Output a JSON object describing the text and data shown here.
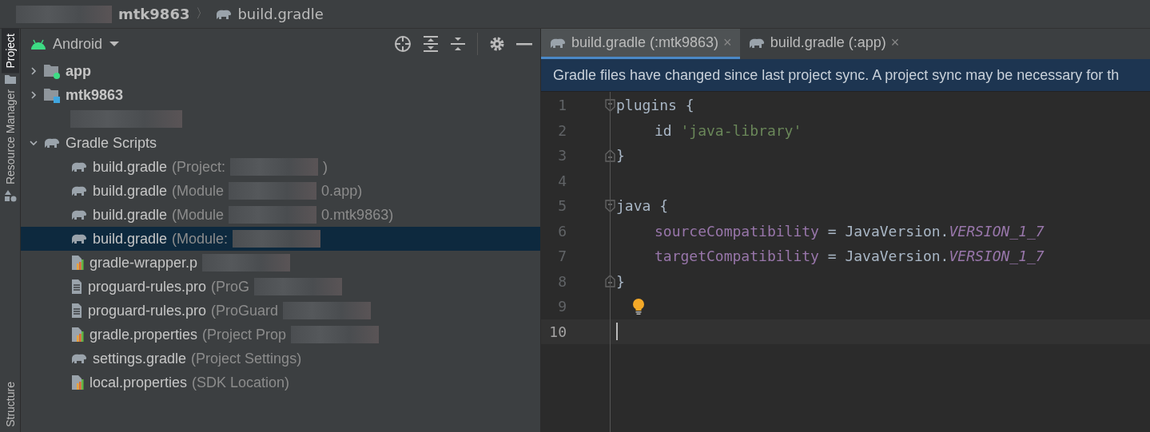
{
  "breadcrumb": {
    "redacted": true,
    "separator": "〉",
    "items": [
      {
        "label": "mtk9863",
        "kind": "module"
      },
      {
        "label": "build.gradle",
        "kind": "gradle"
      }
    ]
  },
  "tool_strip": [
    {
      "label": "Project",
      "selected": true,
      "kind": "folder"
    },
    {
      "label": "Resource Manager",
      "selected": false,
      "kind": "shapes"
    },
    {
      "label": "Structure",
      "selected": false,
      "kind": "plain"
    }
  ],
  "project_panel": {
    "view": "Android",
    "tree": [
      {
        "label": "app",
        "kind": "module",
        "color": "#3ddc84",
        "expanded": false
      },
      {
        "label": "mtk9863",
        "kind": "module",
        "color": "#40a6e0",
        "expanded": false
      },
      {
        "kind": "redacted"
      },
      {
        "label": "Gradle Scripts",
        "kind": "group",
        "expanded": true,
        "children": [
          {
            "label": "build.gradle",
            "detail": "(Project: ",
            "redacted": true,
            "tail": ")",
            "kind": "gradle",
            "selected": false
          },
          {
            "label": "build.gradle",
            "detail": "(Module",
            "redacted": true,
            "tail": "0.app)",
            "kind": "gradle",
            "selected": false
          },
          {
            "label": "build.gradle",
            "detail": "(Module",
            "redacted": true,
            "tail": "0.mtk9863)",
            "kind": "gradle",
            "selected": false
          },
          {
            "label": "build.gradle",
            "detail": "(Module: ",
            "redacted": true,
            "kind": "gradle",
            "selected": true
          },
          {
            "label": "gradle-wrapper.p",
            "redacted": true,
            "kind": "properties",
            "selected": false
          },
          {
            "label": "proguard-rules.pro",
            "detail": "(ProG",
            "redacted": true,
            "kind": "text",
            "selected": false
          },
          {
            "label": "proguard-rules.pro",
            "detail": "(ProGuard",
            "redacted": true,
            "kind": "text",
            "selected": false
          },
          {
            "label": "gradle.properties",
            "detail": "(Project Prop",
            "redacted": true,
            "kind": "properties",
            "selected": false
          },
          {
            "label": "settings.gradle",
            "detail": "(Project Settings)",
            "redacted": false,
            "kind": "gradle",
            "selected": false
          },
          {
            "label": "local.properties",
            "detail": "(SDK Location)",
            "redacted": false,
            "kind": "properties",
            "selected": false
          }
        ]
      }
    ]
  },
  "editor": {
    "tabs": [
      {
        "label": "build.gradle (:mtk9863)",
        "close": "×",
        "selected": true
      },
      {
        "label": "build.gradle (:app)",
        "close": "×",
        "selected": false
      }
    ],
    "banner": "Gradle files have changed since last project sync. A project sync may be necessary for th",
    "lines": [
      {
        "number": "1",
        "kind": "fold_start",
        "tokens": [
          {
            "text": "plugins {",
            "kind": "plain"
          }
        ]
      },
      {
        "number": "2",
        "kind": "indented",
        "tokens": [
          {
            "text": "id ",
            "kind": "plain"
          },
          {
            "text": "'java-library'",
            "kind": "string"
          }
        ]
      },
      {
        "number": "3",
        "kind": "fold_end",
        "tokens": [
          {
            "text": "}",
            "kind": "plain"
          }
        ]
      },
      {
        "number": "4",
        "kind": "blank"
      },
      {
        "number": "5",
        "kind": "fold_start",
        "tokens": [
          {
            "text": "java {",
            "kind": "plain"
          }
        ]
      },
      {
        "number": "6",
        "kind": "indented",
        "tokens": [
          {
            "text": "sourceCompatibility",
            "kind": "field"
          },
          {
            "text": " = JavaVersion.",
            "kind": "plain"
          },
          {
            "text": "VERSION_1_7",
            "kind": "constant"
          }
        ]
      },
      {
        "number": "7",
        "kind": "indented",
        "tokens": [
          {
            "text": "targetCompatibility",
            "kind": "field"
          },
          {
            "text": " = JavaVersion.",
            "kind": "plain"
          },
          {
            "text": "VERSION_1_7",
            "kind": "constant"
          }
        ]
      },
      {
        "number": "8",
        "kind": "fold_end",
        "tokens": [
          {
            "text": "}",
            "kind": "plain"
          }
        ]
      },
      {
        "number": "9",
        "kind": "blank",
        "bulb": true
      },
      {
        "number": "10",
        "kind": "blank",
        "current": true
      }
    ]
  }
}
